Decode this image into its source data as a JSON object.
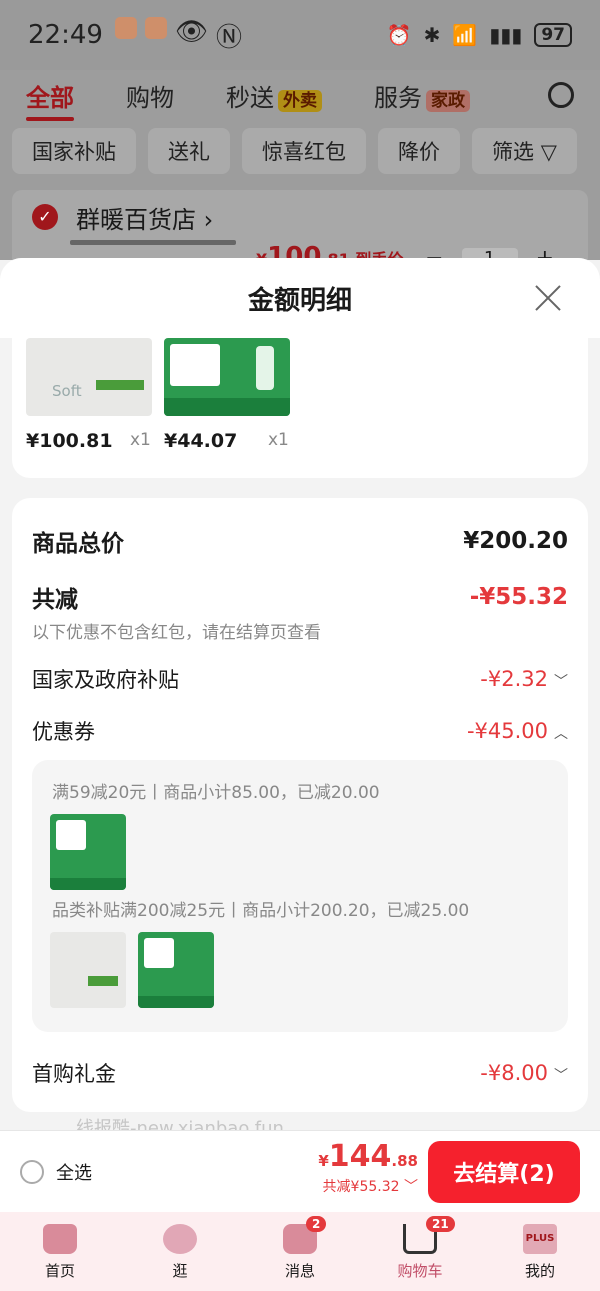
{
  "status_bar": {
    "time": "22:49",
    "battery": "97"
  },
  "top_tabs": [
    {
      "label": "全部"
    },
    {
      "label": "购物"
    },
    {
      "label": "秒送",
      "tag": "外卖"
    },
    {
      "label": "服务",
      "tag": "家政"
    }
  ],
  "filter_chips": [
    "国家补贴",
    "送礼",
    "惊喜红包",
    "降价",
    "筛选"
  ],
  "shop": {
    "name": "群暖百货店 ›",
    "price_prefix": "¥",
    "price_main": "100",
    "price_dec": ".81",
    "price_suffix": " 到手价",
    "qty": "1"
  },
  "sheet": {
    "title": "金额明细",
    "products": [
      {
        "price": "¥100.81",
        "qty": "x1",
        "thumb_label": "Soft"
      },
      {
        "price": "¥44.07",
        "qty": "x1"
      }
    ],
    "rows": {
      "total_label": "商品总价",
      "total_value": "¥200.20",
      "reduce_label": "共减",
      "reduce_value": "-¥55.32",
      "reduce_hint": "以下优惠不包含红包，请在结算页查看",
      "gov_label": "国家及政府补贴",
      "gov_value": "-¥2.32",
      "coupon_label": "优惠券",
      "coupon_value": "-¥45.00",
      "gift_label": "首购礼金",
      "gift_value": "-¥8.00"
    },
    "coupons": [
      {
        "text": "满59减20元丨商品小计85.00，已减20.00"
      },
      {
        "text": "品类补贴满200减25元丨商品小计200.20，已减25.00"
      }
    ]
  },
  "watermark": "线报酷-new.xianbao.fun",
  "checkout": {
    "select_all": "全选",
    "currency": "¥",
    "total_main": "144",
    "total_dec": ".88",
    "discount": "共减¥55.32",
    "pay_button": "去结算(2)"
  },
  "tabbar": [
    {
      "label": "首页"
    },
    {
      "label": "逛"
    },
    {
      "label": "消息",
      "badge": "2"
    },
    {
      "label": "购物车",
      "badge": "21"
    },
    {
      "label": "我的",
      "icon_text": "PLUS"
    }
  ],
  "colors": {
    "accent_red": "#e4393c",
    "pay_button": "#f5212d"
  }
}
